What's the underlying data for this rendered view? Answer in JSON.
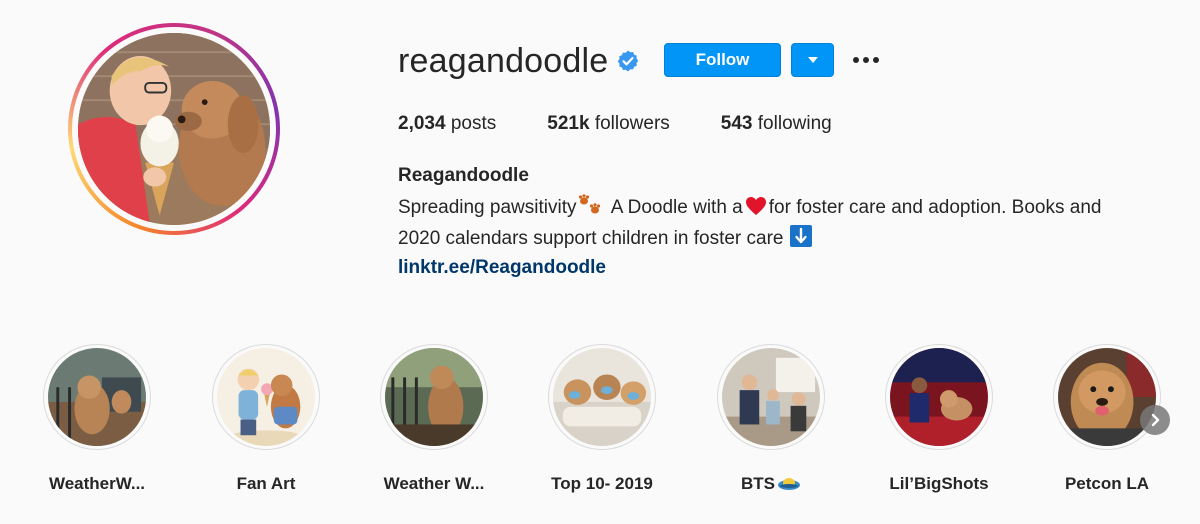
{
  "profile": {
    "username": "reagandoodle",
    "verified": true,
    "follow_label": "Follow",
    "stats": {
      "posts_count": "2,034",
      "posts_label": "posts",
      "followers_count": "521k",
      "followers_label": "followers",
      "following_count": "543",
      "following_label": "following"
    },
    "display_name": "Reagandoodle",
    "bio_line1_a": "Spreading pawsitivity",
    "bio_line1_b": " A Doodle with a",
    "bio_line1_c": "for foster care and adoption. Books and",
    "bio_line2": "2020 calendars support children in foster care",
    "link": "linktr.ee/Reagandoodle"
  },
  "highlights": [
    {
      "label": "WeatherW...",
      "icon": "dog-on-porch-image"
    },
    {
      "label": "Fan Art",
      "icon": "dog-and-boy-illustration-image"
    },
    {
      "label": "Weather W...",
      "icon": "dog-on-railing-image"
    },
    {
      "label": "Top 10- 2019",
      "icon": "dogs-in-bed-image"
    },
    {
      "label": "BTS",
      "icon": "studio-scene-image"
    },
    {
      "label": "Lil’BigShots",
      "icon": "tv-stage-image"
    },
    {
      "label": "Petcon LA",
      "icon": "dog-portrait-image"
    }
  ],
  "colors": {
    "accent": "#0095f6",
    "link": "#00376b",
    "verified": "#3897f0",
    "text": "#262626"
  }
}
